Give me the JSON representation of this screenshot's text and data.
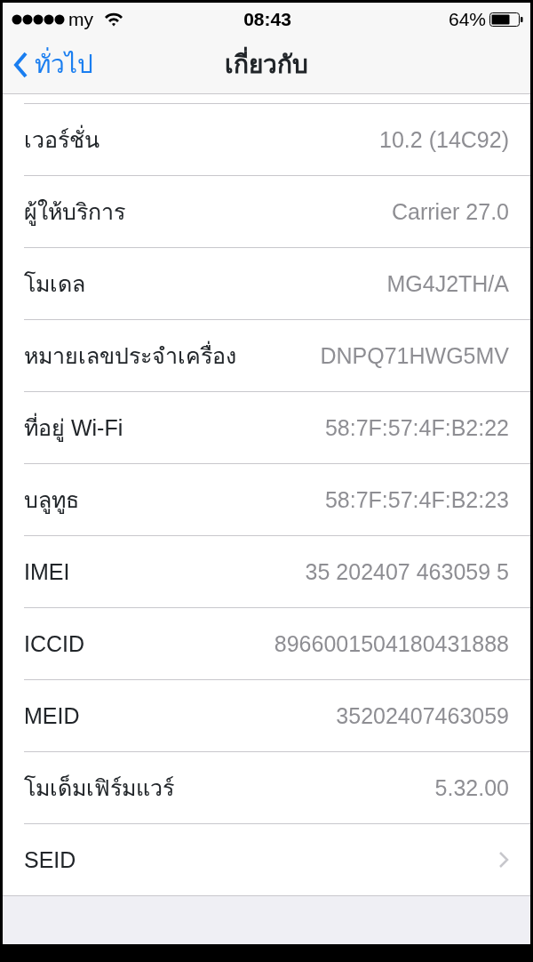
{
  "status_bar": {
    "carrier": "my",
    "time": "08:43",
    "battery": "64%"
  },
  "nav": {
    "back": "ทั่วไป",
    "title": "เกี่ยวกับ"
  },
  "rows": [
    {
      "kind": "value",
      "label": "เวอร์ชั่น",
      "value": "10.2 (14C92)"
    },
    {
      "kind": "value",
      "label": "ผู้ให้บริการ",
      "value": "Carrier 27.0"
    },
    {
      "kind": "value",
      "label": "โมเดล",
      "value": "MG4J2TH/A"
    },
    {
      "kind": "value",
      "label": "หมายเลขประจำเครื่อง",
      "value": "DNPQ71HWG5MV"
    },
    {
      "kind": "value",
      "label": "ที่อยู่ Wi-Fi",
      "value": "58:7F:57:4F:B2:22"
    },
    {
      "kind": "value",
      "label": "บลูทูธ",
      "value": "58:7F:57:4F:B2:23"
    },
    {
      "kind": "value",
      "label": "IMEI",
      "value": "35 202407 463059 5"
    },
    {
      "kind": "value",
      "label": "ICCID",
      "value": "8966001504180431888"
    },
    {
      "kind": "value",
      "label": "MEID",
      "value": "35202407463059"
    },
    {
      "kind": "value",
      "label": "โมเด็มเฟิร์มแวร์",
      "value": "5.32.00"
    },
    {
      "kind": "disclosure",
      "label": "SEID"
    }
  ]
}
